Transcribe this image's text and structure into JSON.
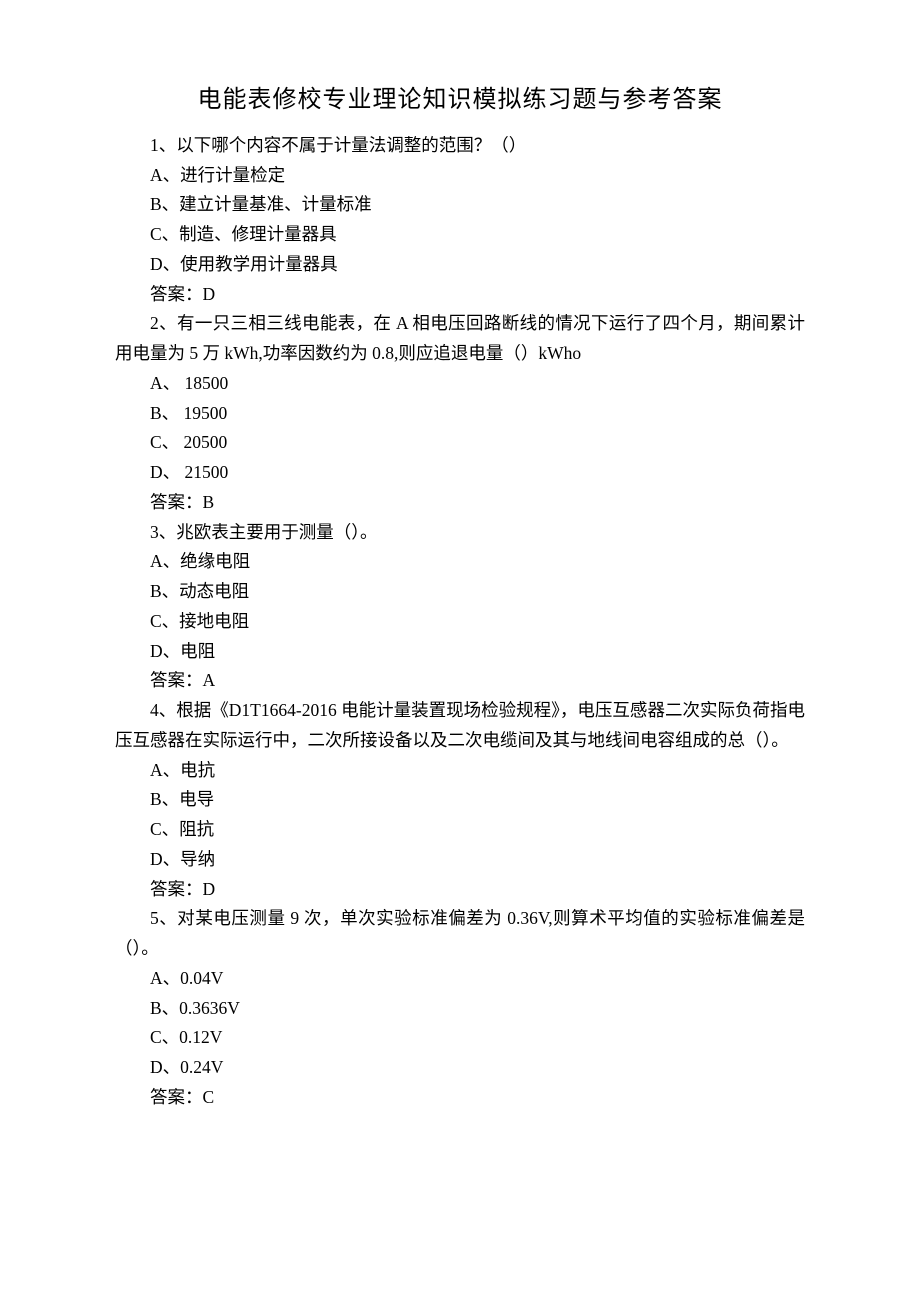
{
  "title": "电能表修校专业理论知识模拟练习题与参考答案",
  "questions": [
    {
      "stem": "1、以下哪个内容不属于计量法调整的范围？（）",
      "options": [
        "A、进行计量检定",
        "B、建立计量基准、计量标准",
        "C、制造、修理计量器具",
        "D、使用教学用计量器具"
      ],
      "answer": "答案：D"
    },
    {
      "stem": "2、有一只三相三线电能表，在 A 相电压回路断线的情况下运行了四个月，期间累计用电量为 5 万 kWh,功率因数约为 0.8,则应追退电量（）kWho",
      "options": [
        "A、 18500",
        "B、 19500",
        "C、 20500",
        "D、 21500"
      ],
      "answer": "答案：B"
    },
    {
      "stem": "3、兆欧表主要用于测量（）。",
      "options": [
        "A、绝缘电阻",
        "B、动态电阻",
        "C、接地电阻",
        "D、电阻"
      ],
      "answer": "答案：A"
    },
    {
      "stem": "4、根据《D1T1664-2016 电能计量装置现场检验规程》，电压互感器二次实际负荷指电压互感器在实际运行中，二次所接设备以及二次电缆间及其与地线间电容组成的总（）。",
      "options": [
        "A、电抗",
        "B、电导",
        "C、阻抗",
        "D、导纳"
      ],
      "answer": "答案：D"
    },
    {
      "stem": "5、对某电压测量 9 次，单次实验标准偏差为 0.36V,则算术平均值的实验标准偏差是（）。",
      "options": [
        "A、0.04V",
        "B、0.3636V",
        "C、0.12V",
        "D、0.24V"
      ],
      "answer": "答案：C"
    }
  ]
}
